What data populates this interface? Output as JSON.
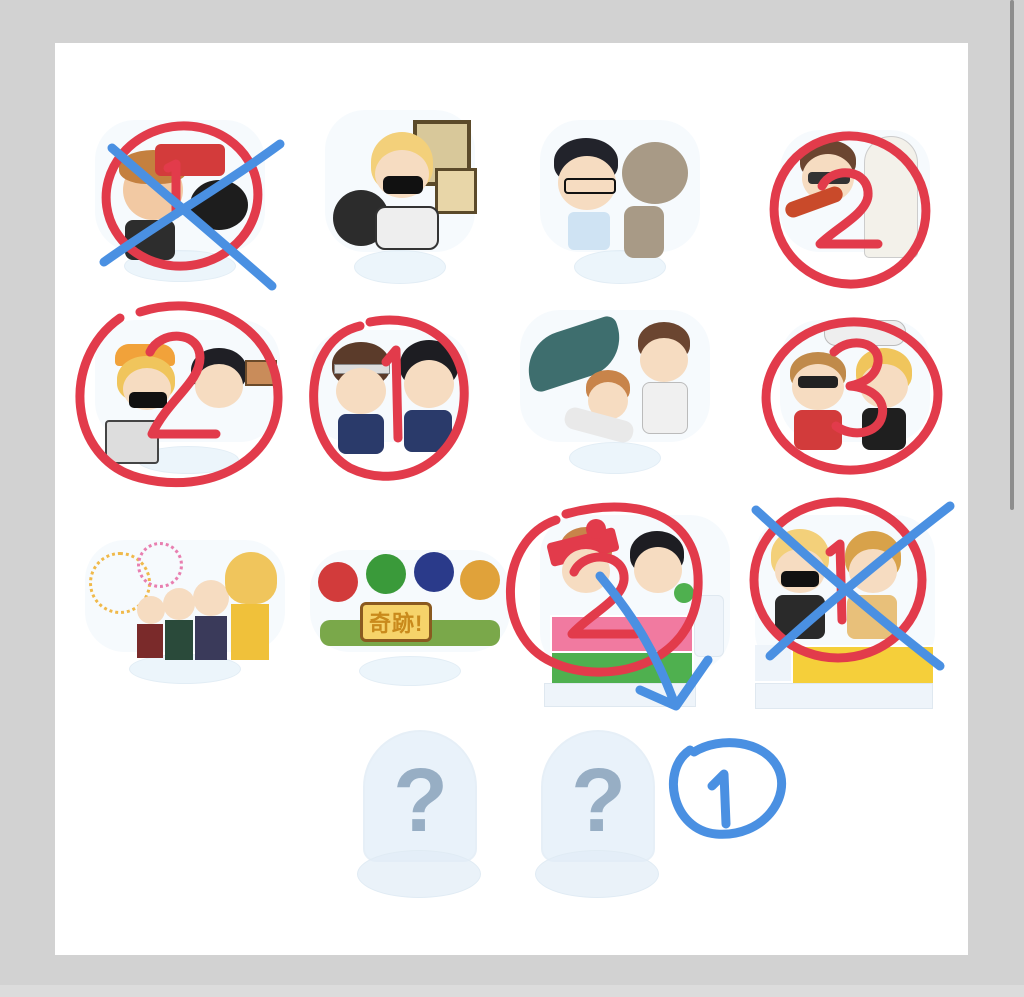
{
  "grid": {
    "items": [
      {
        "id": "a1",
        "annotation": "1",
        "status": "crossed",
        "color": "#e23b4b"
      },
      {
        "id": "a2",
        "annotation": "",
        "status": "plain"
      },
      {
        "id": "a3",
        "annotation": "",
        "status": "plain"
      },
      {
        "id": "a4",
        "annotation": "2",
        "status": "circled"
      },
      {
        "id": "b1",
        "annotation": "2",
        "status": "circled"
      },
      {
        "id": "b2",
        "annotation": "1",
        "status": "circled"
      },
      {
        "id": "b3",
        "annotation": "",
        "status": "plain"
      },
      {
        "id": "b4",
        "annotation": "3",
        "status": "circled"
      },
      {
        "id": "c1",
        "annotation": "",
        "status": "plain"
      },
      {
        "id": "c2",
        "annotation": "",
        "status": "plain",
        "sign_text": "奇跡!"
      },
      {
        "id": "c3",
        "annotation": "2",
        "status": "circled"
      },
      {
        "id": "c4",
        "annotation": "1",
        "status": "crossed"
      },
      {
        "id": "d1",
        "annotation": "",
        "status": "secret",
        "glyph": "?"
      },
      {
        "id": "d2",
        "annotation": "",
        "status": "secret",
        "glyph": "?"
      }
    ],
    "secret_note": "1"
  },
  "colors": {
    "red_marker": "#e23b4b",
    "blue_marker": "#4a90e2",
    "frame": "#d2d2d2",
    "paper": "#ffffff"
  }
}
